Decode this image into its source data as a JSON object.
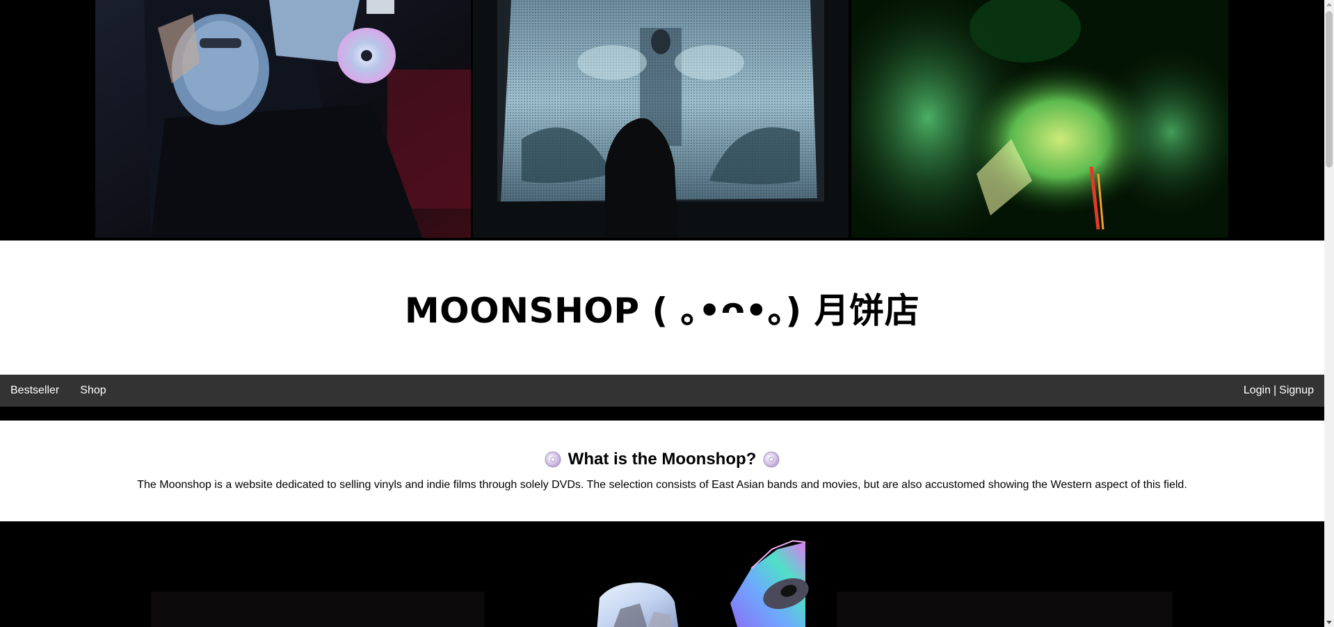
{
  "header": {
    "title": "MOONSHOP ( ｡•ᴖ•｡) 月饼店"
  },
  "nav": {
    "items": [
      {
        "label": "Bestseller"
      },
      {
        "label": "Shop"
      }
    ],
    "login": "Login",
    "separator": "|",
    "signup": "Signup"
  },
  "about": {
    "heading": "What is the Moonshop?",
    "icon": "cd-disc-icon",
    "text": "The Moonshop is a website dedicated to selling vinyls and indie films through solely DVDs. The selection consists of East Asian bands and movies, but are also accustomed showing the Western aspect of this field."
  },
  "colors": {
    "navbar": "#333333",
    "background": "#000000",
    "panel": "#ffffff"
  }
}
